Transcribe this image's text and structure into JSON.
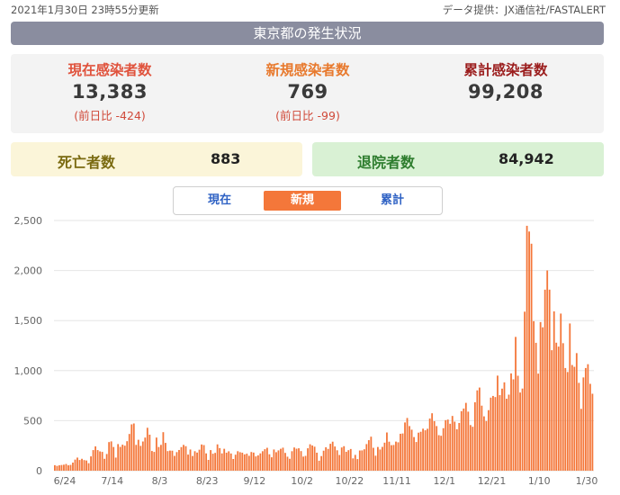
{
  "header": {
    "updated": "2021年1月30日 23時55分更新",
    "source": "データ提供：JX通信社/FASTALERT",
    "title": "東京都の発生状況"
  },
  "stats": {
    "current": {
      "label": "現在感染者数",
      "value": "13,383",
      "diff": "(前日比 -424)"
    },
    "new": {
      "label": "新規感染者数",
      "value": "769",
      "diff": "(前日比 -99)"
    },
    "total": {
      "label": "累計感染者数",
      "value": "99,208"
    }
  },
  "boxes": {
    "deaths": {
      "label": "死亡者数",
      "value": "883"
    },
    "recovered": {
      "label": "退院者数",
      "value": "84,942"
    }
  },
  "tabs": {
    "current": "現在",
    "new": "新規",
    "total": "累計",
    "active": "new"
  },
  "colors": {
    "bar": "#f4773a",
    "grid": "#e6e6e6",
    "accent": "#f4773a"
  },
  "chart_data": {
    "type": "bar",
    "x_tick_labels": [
      "6/24",
      "7/14",
      "8/3",
      "8/23",
      "9/12",
      "10/2",
      "10/22",
      "11/11",
      "12/1",
      "12/21",
      "1/10",
      "1/30"
    ],
    "y_ticks": [
      "0",
      "500",
      "1,000",
      "1,500",
      "2,000",
      "2,500"
    ],
    "ylim": [
      0,
      2500
    ],
    "grid": true,
    "start_date": "6/24",
    "end_date": "1/30",
    "values": [
      55,
      48,
      54,
      57,
      60,
      67,
      54,
      58,
      81,
      111,
      131,
      107,
      119,
      106,
      102,
      75,
      143,
      206,
      243,
      206,
      193,
      188,
      119,
      167,
      286,
      293,
      237,
      131,
      266,
      238,
      260,
      250,
      295,
      367,
      463,
      472,
      258,
      309,
      248,
      292,
      331,
      429,
      360,
      197,
      188,
      331,
      237,
      258,
      385,
      278,
      196,
      201,
      200,
      148,
      186,
      207,
      236,
      258,
      245,
      161,
      212,
      147,
      195,
      181,
      210,
      262,
      256,
      173,
      108,
      206,
      170,
      178,
      263,
      226,
      173,
      219,
      180,
      194,
      172,
      117,
      160,
      195,
      185,
      180,
      163,
      170,
      149,
      187,
      181,
      143,
      153,
      173,
      195,
      215,
      229,
      164,
      134,
      212,
      185,
      203,
      219,
      230,
      178,
      140,
      119,
      195,
      232,
      220,
      224,
      196,
      141,
      148,
      224,
      264,
      252,
      240,
      180,
      100,
      146,
      200,
      234,
      218,
      269,
      290,
      242,
      204,
      157,
      232,
      245,
      189,
      205,
      217,
      123,
      158,
      116,
      202,
      203,
      214,
      266,
      305,
      340,
      229,
      150,
      237,
      212,
      238,
      280,
      382,
      290,
      255,
      257,
      291,
      284,
      369,
      372,
      482,
      527,
      446,
      410,
      336,
      287,
      380,
      389,
      420,
      404,
      419,
      521,
      574,
      495,
      446,
      355,
      349,
      425,
      505,
      511,
      469,
      547,
      490,
      414,
      477,
      595,
      621,
      678,
      590,
      456,
      439,
      684,
      803,
      831,
      650,
      543,
      496,
      605,
      730,
      747,
      736,
      950,
      755,
      820,
      883,
      719,
      760,
      972,
      913,
      1337,
      949,
      781,
      821,
      1589,
      2447,
      2390,
      2268,
      1494,
      1278,
      970,
      1485,
      1433,
      1809,
      2001,
      1809,
      1204,
      1592,
      1279,
      1240,
      1570,
      1274,
      1026,
      986,
      1471,
      1056,
      1038,
      1175,
      878,
      618,
      932,
      1026,
      1064,
      868,
      769
    ]
  }
}
